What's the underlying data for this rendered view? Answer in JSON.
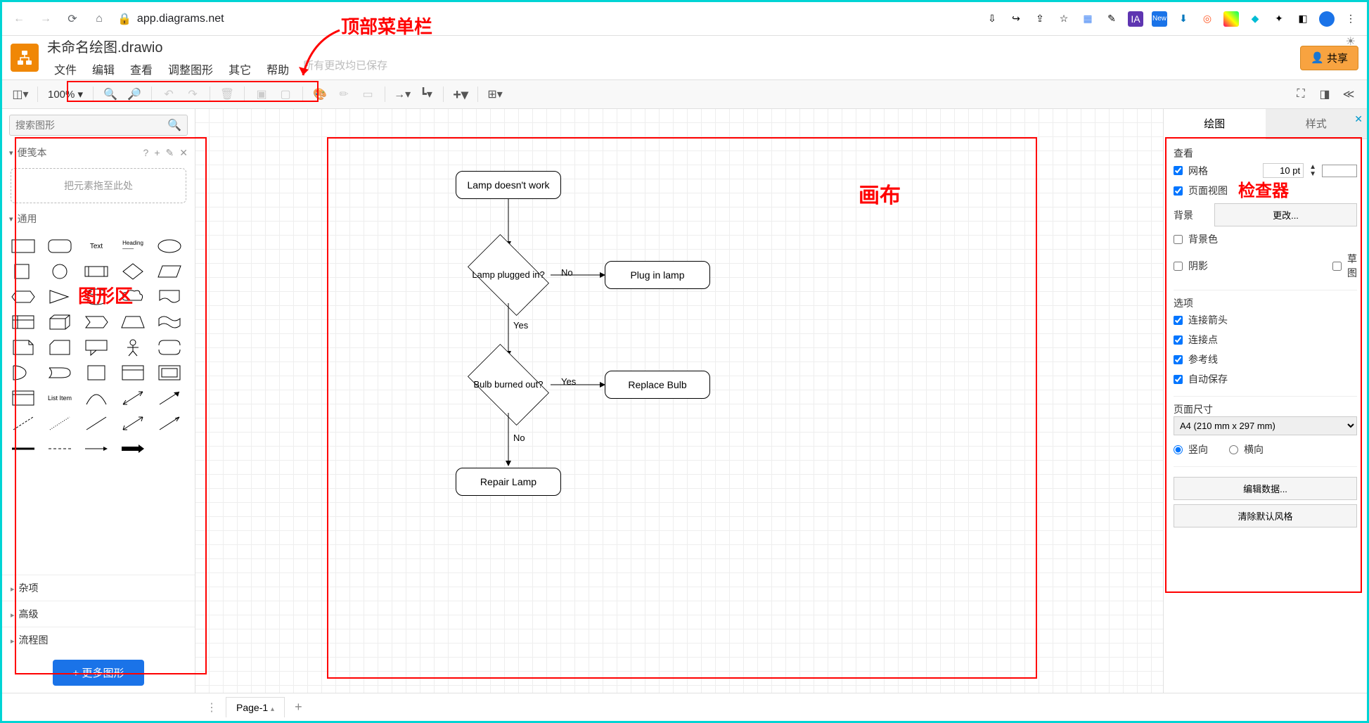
{
  "browser": {
    "url_host": "app.diagrams.net"
  },
  "annotations": {
    "top_menu": "顶部菜单栏",
    "shape_area": "图形区",
    "canvas": "画布",
    "inspector": "检查器"
  },
  "header": {
    "title": "未命名绘图.drawio",
    "menus": [
      "文件",
      "编辑",
      "查看",
      "调整图形",
      "其它",
      "帮助"
    ],
    "save_status": "所有更改均已保存",
    "share": "共享"
  },
  "toolbar": {
    "zoom": "100%"
  },
  "left": {
    "search_placeholder": "搜索图形",
    "scratchpad": "便笺本",
    "dropzone": "把元素拖至此处",
    "general": "通用",
    "cats": [
      "杂项",
      "高级",
      "流程图"
    ],
    "more": "+ 更多图形"
  },
  "chart_data": {
    "type": "flowchart",
    "nodes": [
      {
        "id": "start",
        "shape": "rounded",
        "text": "Lamp doesn't work"
      },
      {
        "id": "d1",
        "shape": "decision",
        "text": "Lamp plugged in?"
      },
      {
        "id": "a1",
        "shape": "rounded",
        "text": "Plug in lamp"
      },
      {
        "id": "d2",
        "shape": "decision",
        "text": "Bulb burned out?"
      },
      {
        "id": "a2",
        "shape": "rounded",
        "text": "Replace Bulb"
      },
      {
        "id": "end",
        "shape": "rounded",
        "text": "Repair Lamp"
      }
    ],
    "edges": [
      {
        "from": "start",
        "to": "d1",
        "label": ""
      },
      {
        "from": "d1",
        "to": "a1",
        "label": "No"
      },
      {
        "from": "d1",
        "to": "d2",
        "label": "Yes"
      },
      {
        "from": "d2",
        "to": "a2",
        "label": "Yes"
      },
      {
        "from": "d2",
        "to": "end",
        "label": "No"
      }
    ]
  },
  "right": {
    "tab_diagram": "绘图",
    "tab_style": "样式",
    "view": "查看",
    "grid": "网格",
    "grid_val": "10 pt",
    "page_view": "页面视图",
    "background": "背景",
    "change": "更改...",
    "bgcolor": "背景色",
    "shadow": "阴影",
    "sketch": "草图",
    "options": "选项",
    "conn_arrows": "连接箭头",
    "conn_points": "连接点",
    "guides": "参考线",
    "autosave": "自动保存",
    "page_size": "页面尺寸",
    "page_size_val": "A4 (210 mm x 297 mm)",
    "portrait": "竖向",
    "landscape": "横向",
    "edit_data": "编辑数据...",
    "clear_style": "清除默认风格"
  },
  "footer": {
    "page": "Page-1"
  }
}
